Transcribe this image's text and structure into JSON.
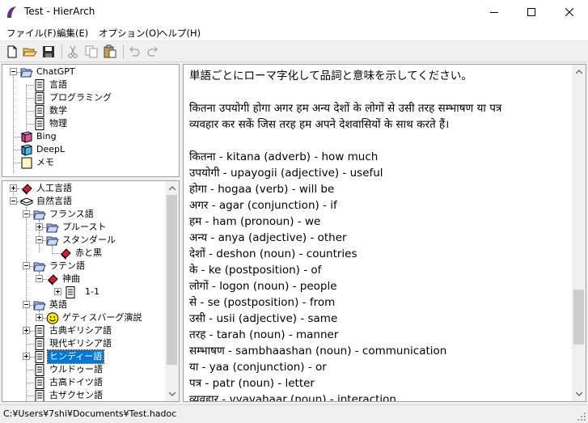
{
  "window": {
    "title": "Test - HierArch",
    "minimize_label": "minimize",
    "maximize_label": "maximize",
    "close_label": "close"
  },
  "menu": {
    "file": "ファイル(F)",
    "edit": "編集(E)",
    "options": "オプション(O)",
    "help": "ヘルプ(H)"
  },
  "toolbar": {
    "icons": [
      "new-document-icon",
      "open-folder-icon",
      "save-icon",
      "cut-icon",
      "copy-icon",
      "paste-icon",
      "undo-icon",
      "redo-icon"
    ]
  },
  "tree_top": [
    {
      "label": "ChatGPT",
      "icon": "open-folder-icon",
      "expanded": true
    },
    {
      "label": "言語",
      "icon": "document-icon"
    },
    {
      "label": "プログラミング",
      "icon": "document-icon"
    },
    {
      "label": "数学",
      "icon": "document-icon"
    },
    {
      "label": "物理",
      "icon": "document-icon"
    },
    {
      "label": "Bing",
      "icon": "book-icon"
    },
    {
      "label": "DeepL",
      "icon": "book-icon"
    },
    {
      "label": "メモ",
      "icon": "note-icon"
    }
  ],
  "tree_bottom": [
    {
      "label": "人工言語",
      "icon": "red-book-icon",
      "expander": "plus"
    },
    {
      "label": "自然言語",
      "icon": "open-book-icon",
      "expander": "minus"
    },
    {
      "label": "フランス語",
      "icon": "open-folder-icon",
      "expander": "minus"
    },
    {
      "label": "プルースト",
      "icon": "open-folder-icon",
      "expander": "plus"
    },
    {
      "label": "スタンダール",
      "icon": "open-folder-icon",
      "expander": "minus"
    },
    {
      "label": "赤と黒",
      "icon": "red-book-icon"
    },
    {
      "label": "ラテン語",
      "icon": "open-folder-icon",
      "expander": "minus"
    },
    {
      "label": "神曲",
      "icon": "red-book-icon",
      "expander": "minus"
    },
    {
      "label": "1-1",
      "icon": "document-icon",
      "expander": "plus"
    },
    {
      "label": "英語",
      "icon": "open-folder-icon",
      "expander": "minus"
    },
    {
      "label": "ゲティスバーグ演説",
      "icon": "smiley-icon",
      "expander": "plus"
    },
    {
      "label": "古典ギリシア語",
      "icon": "document-icon",
      "expander": "plus"
    },
    {
      "label": "現代ギリシア語",
      "icon": "document-icon"
    },
    {
      "label": "ヒンディー語",
      "icon": "document-icon",
      "expander": "plus",
      "selected": true
    },
    {
      "label": "ウルドゥー語",
      "icon": "document-icon"
    },
    {
      "label": "古高ドイツ語",
      "icon": "document-icon"
    },
    {
      "label": "古ザクセン語",
      "icon": "document-icon"
    }
  ],
  "editor": {
    "lines": [
      "単語ごとにローマ字化して品詞と意味を示してください。",
      "",
      "कितना उपयोगी होगा अगर हम अन्य देशों के लोगों से उसी तरह सम्भाषण या पत्र",
      "व्यवहार कर सकें जिस तरह हम अपने देशवासियों के साथ करते हैं।",
      "",
      "कितना - kitana (adverb) - how much",
      "उपयोगी - upayogii (adjective) - useful",
      "होगा - hogaa (verb) - will be",
      "अगर - agar (conjunction) - if",
      "हम - ham (pronoun) - we",
      "अन्य - anya (adjective) - other",
      "देशों - deshon (noun) - countries",
      "के - ke (postposition) - of",
      "लोगों - logon (noun) - people",
      "से - se (postposition) - from",
      "उसी - usii (adjective) - same",
      "तरह - tarah (noun) - manner",
      "सम्भाषण - sambhaashan (noun) - communication",
      "या - yaa (conjunction) - or",
      "पत्र - patr (noun) - letter",
      "व्यवहार - vyavahaar (noun) - interaction"
    ]
  },
  "status": {
    "path": "C:¥Users¥7shi¥Documents¥Test.hadoc"
  },
  "colors": {
    "selection": "#0078d7",
    "folder": "#a9c3ee",
    "red_book": "#d22424",
    "pink_book": "#d63a8a"
  }
}
